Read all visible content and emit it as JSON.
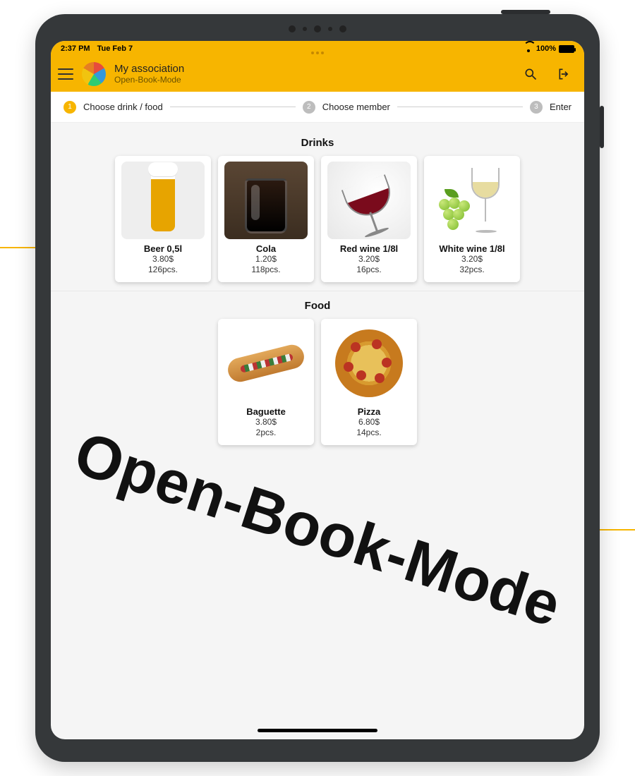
{
  "status": {
    "time": "2:37 PM",
    "date": "Tue Feb 7",
    "battery_pct": "100%"
  },
  "header": {
    "title": "My association",
    "subtitle": "Open-Book-Mode"
  },
  "stepper": {
    "step1": {
      "num": "1",
      "label": "Choose drink / food"
    },
    "step2": {
      "num": "2",
      "label": "Choose member"
    },
    "step3": {
      "num": "3",
      "label": "Enter"
    }
  },
  "sections": {
    "drinks": {
      "title": "Drinks",
      "items": [
        {
          "name": "Beer 0,5l",
          "price": "3.80$",
          "stock": "126pcs."
        },
        {
          "name": "Cola",
          "price": "1.20$",
          "stock": "118pcs."
        },
        {
          "name": "Red wine 1/8l",
          "price": "3.20$",
          "stock": "16pcs."
        },
        {
          "name": "White wine 1/8l",
          "price": "3.20$",
          "stock": "32pcs."
        }
      ]
    },
    "food": {
      "title": "Food",
      "items": [
        {
          "name": "Baguette",
          "price": "3.80$",
          "stock": "2pcs."
        },
        {
          "name": "Pizza",
          "price": "6.80$",
          "stock": "14pcs."
        }
      ]
    }
  },
  "watermark": "Open-Book-Mode"
}
